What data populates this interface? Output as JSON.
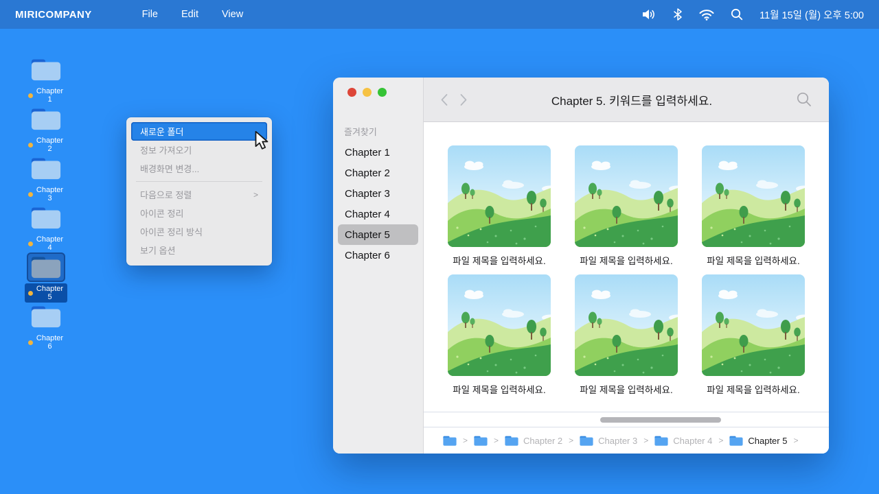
{
  "menubar": {
    "brand": "MIRICOMPANY",
    "menus": [
      {
        "label": "File"
      },
      {
        "label": "Edit"
      },
      {
        "label": "View"
      }
    ],
    "datetime": "11월 15일 (월) 오후 5:00"
  },
  "desktop": {
    "icons": [
      {
        "label": "Chapter 1",
        "selected": false
      },
      {
        "label": "Chapter 2",
        "selected": false
      },
      {
        "label": "Chapter 3",
        "selected": false
      },
      {
        "label": "Chapter 4",
        "selected": false
      },
      {
        "label": "Chapter 5",
        "selected": true
      },
      {
        "label": "Chapter 6",
        "selected": false
      }
    ]
  },
  "context_menu": {
    "items": [
      {
        "label": "새로운 폴더",
        "highlighted": true
      },
      {
        "label": "정보 가져오기"
      },
      {
        "label": "배경화면 변경..."
      },
      {
        "label": "다음으로 정렬",
        "submenu_arrow": ">"
      },
      {
        "label": "아이콘 정리"
      },
      {
        "label": "아이콘 정리 방식"
      },
      {
        "label": "보기 옵션"
      }
    ]
  },
  "window": {
    "sidebar": {
      "section": "즐겨찾기",
      "items": [
        {
          "label": "Chapter 1",
          "selected": false
        },
        {
          "label": "Chapter 2",
          "selected": false
        },
        {
          "label": "Chapter 3",
          "selected": false
        },
        {
          "label": "Chapter 4",
          "selected": false
        },
        {
          "label": "Chapter 5",
          "selected": true
        },
        {
          "label": "Chapter 6",
          "selected": false
        }
      ]
    },
    "header": {
      "title": "Chapter 5. 키워드를 입력하세요."
    },
    "files": [
      {
        "caption": "파일 제목을 입력하세요."
      },
      {
        "caption": "파일 제목을 입력하세요."
      },
      {
        "caption": "파일 제목을 입력하세요."
      },
      {
        "caption": "파일 제목을 입력하세요."
      },
      {
        "caption": "파일 제목을 입력하세요."
      },
      {
        "caption": "파일 제목을 입력하세요."
      }
    ],
    "breadcrumb": {
      "separator": ">",
      "items": [
        {
          "label": "",
          "current": false
        },
        {
          "label": "",
          "current": false
        },
        {
          "label": "Chapter 2",
          "current": false
        },
        {
          "label": "Chapter 3",
          "current": false
        },
        {
          "label": "Chapter 4",
          "current": false
        },
        {
          "label": "Chapter 5",
          "current": true
        }
      ]
    }
  },
  "colors": {
    "desktop_bg": "#2b8ff8",
    "menubar_bg": "#2a78d3",
    "menu_highlight": "#2583e8",
    "folder_body": "#a7cef4",
    "folder_tab": "#1a64d4",
    "breadcrumb_folder": "#55a4f1",
    "sidebar_bg": "#ededee",
    "sidebar_selected": "#bfbfc1",
    "traffic_red": "#dd4638",
    "traffic_yellow": "#f6c243",
    "traffic_green": "#35c335",
    "label_dot": "#f2b53d"
  }
}
